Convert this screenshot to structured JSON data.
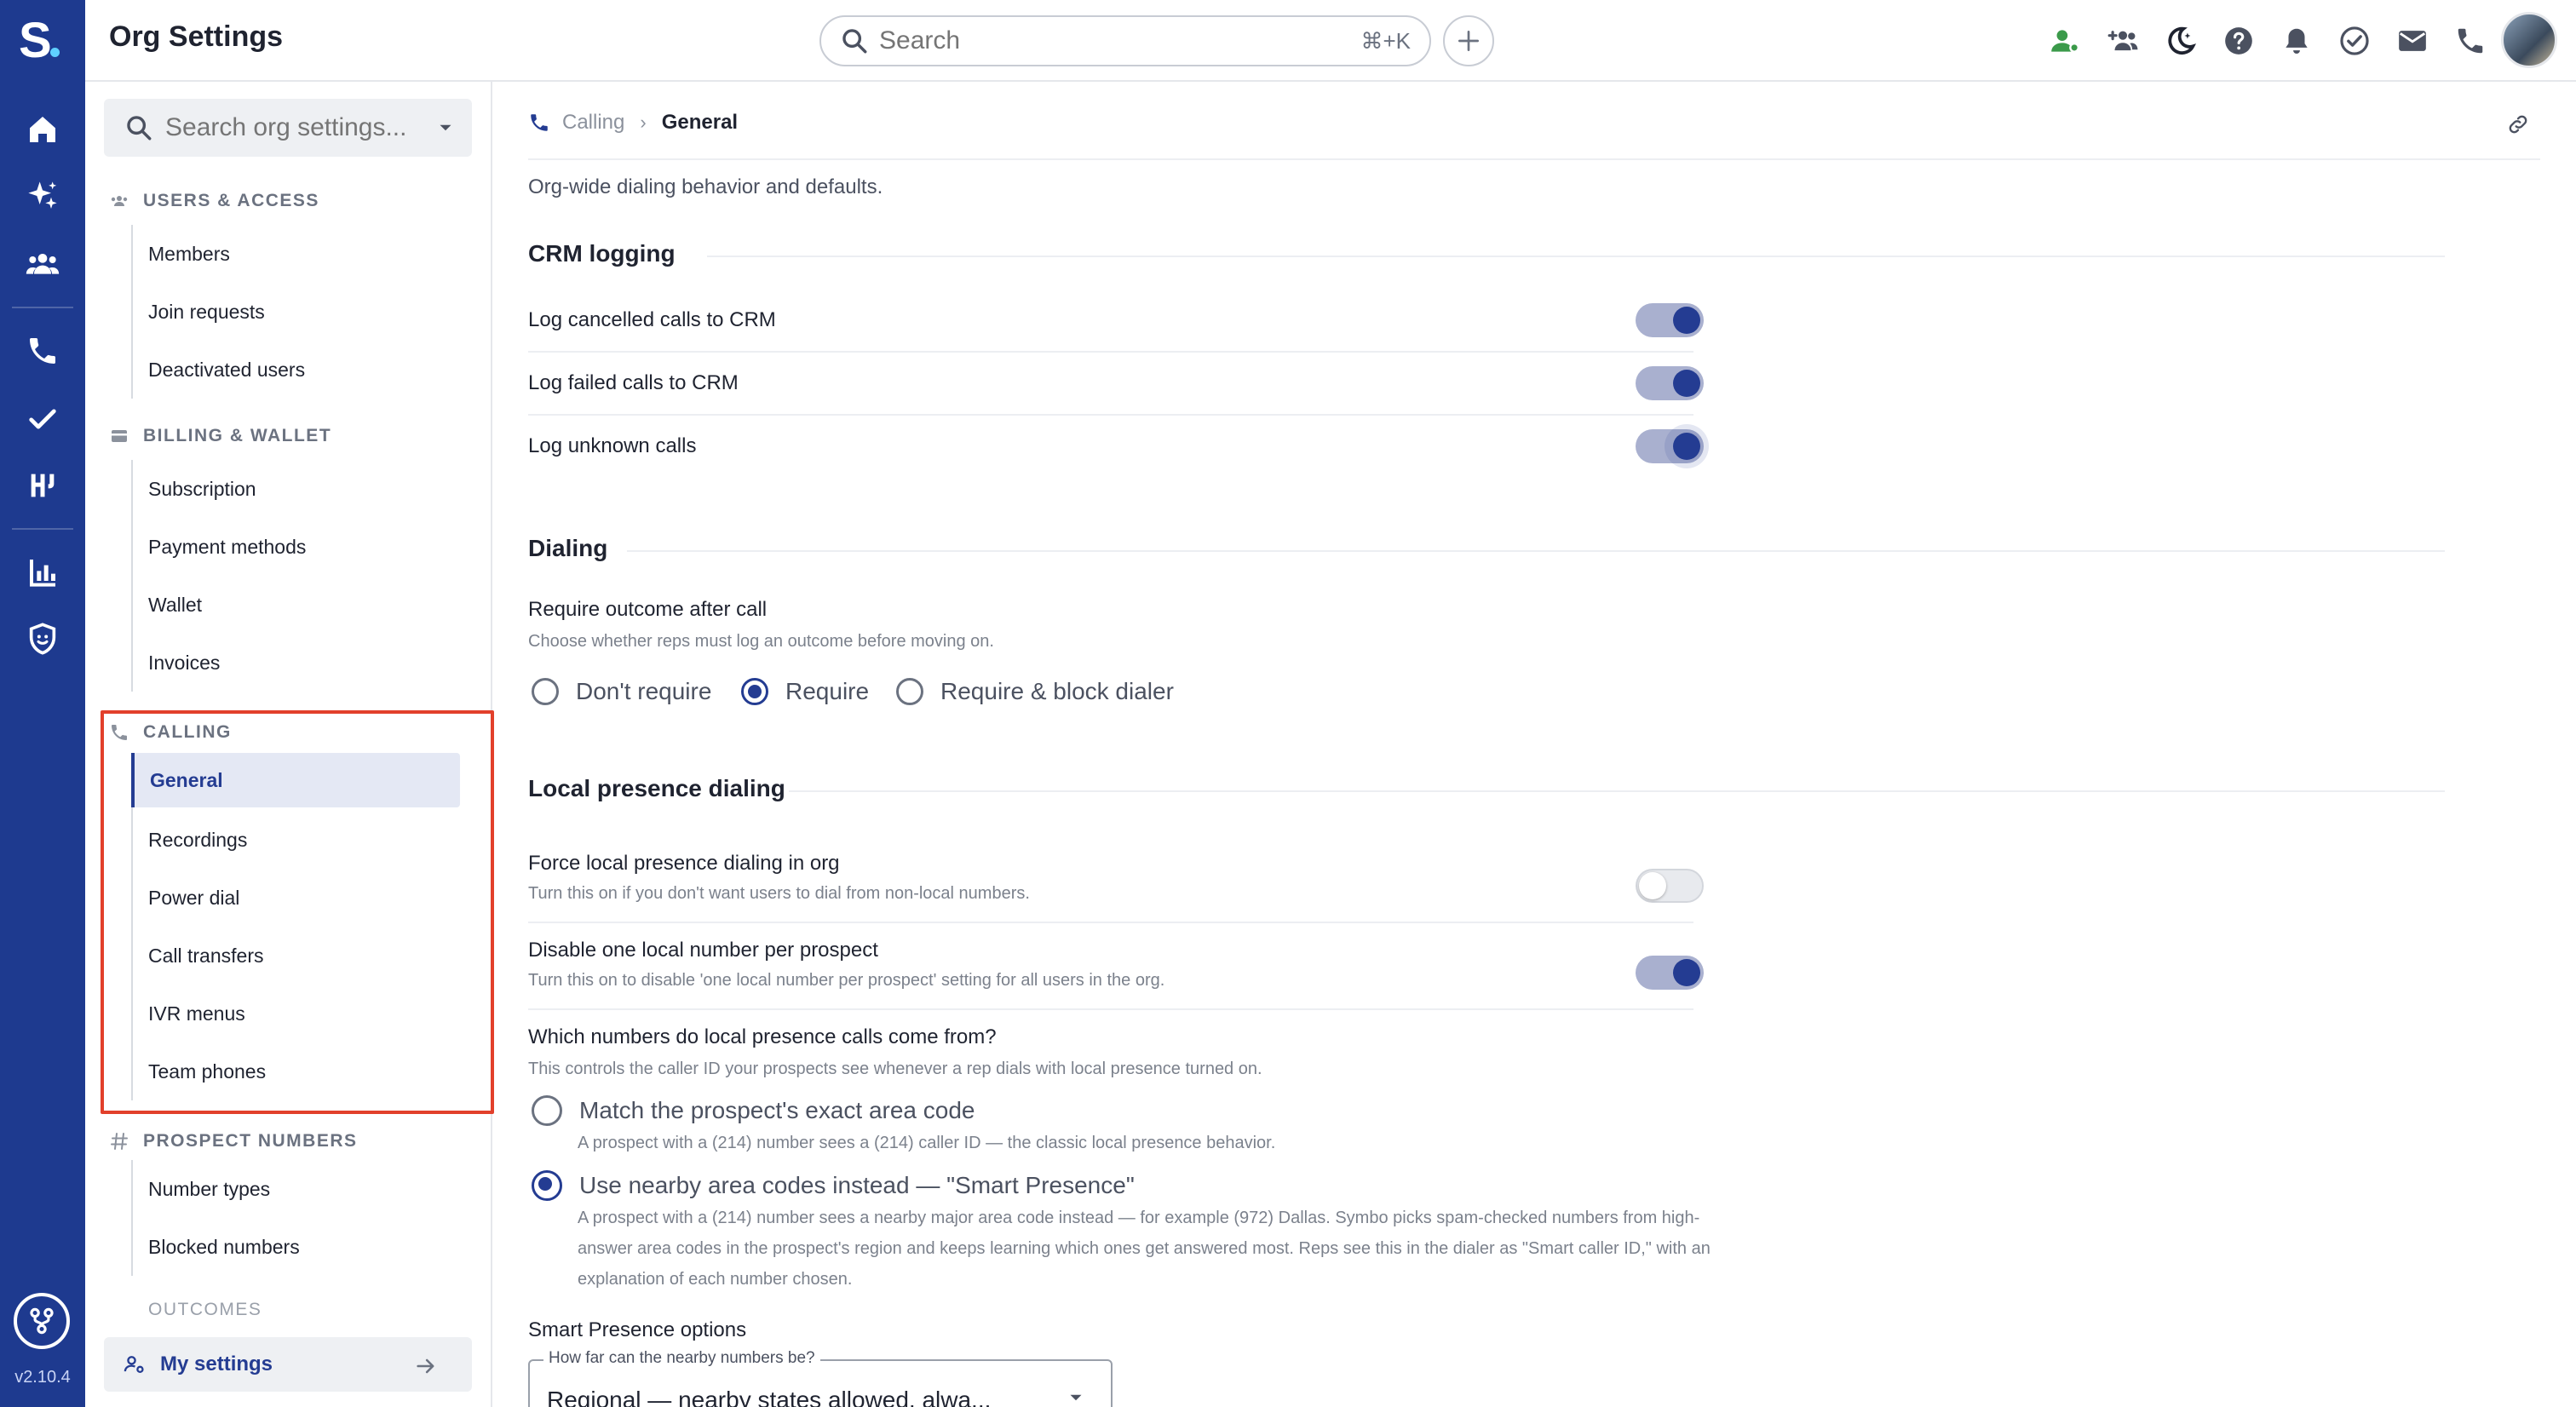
{
  "app": {
    "title": "Org Settings",
    "version": "v2.10.4",
    "accent": "#243c92",
    "rail_color": "#1e3a8f"
  },
  "topbar": {
    "search_placeholder": "Search",
    "search_shortcut": "⌘+K",
    "icons": [
      "user-status-icon",
      "add-group-icon",
      "dnd-moon-icon",
      "help-icon",
      "bell-icon",
      "task-check-icon",
      "mail-icon",
      "phone-icon"
    ]
  },
  "rail": {
    "icons": [
      "home-icon",
      "ai-sparkle-icon",
      "team-icon",
      "phone-icon",
      "check-icon",
      "integrations-icon",
      "analytics-icon",
      "shield-icon"
    ]
  },
  "sidebar": {
    "search_placeholder": "Search org settings...",
    "sections": [
      {
        "title": "USERS & ACCESS",
        "icon": "people-icon",
        "items": [
          "Members",
          "Join requests",
          "Deactivated users"
        ]
      },
      {
        "title": "BILLING & WALLET",
        "icon": "card-icon",
        "items": [
          "Subscription",
          "Payment methods",
          "Wallet",
          "Invoices"
        ]
      },
      {
        "title": "CALLING",
        "icon": "phone-icon",
        "items": [
          "General",
          "Recordings",
          "Power dial",
          "Call transfers",
          "IVR menus",
          "Team phones"
        ],
        "active": "General"
      },
      {
        "title": "PROSPECT NUMBERS",
        "icon": "hash-icon",
        "items": [
          "Number types",
          "Blocked numbers"
        ]
      }
    ],
    "faded_section": "OUTCOMES",
    "my_settings": "My settings"
  },
  "main": {
    "breadcrumb": {
      "parent": "Calling",
      "current": "General"
    },
    "description": "Org-wide dialing behavior and defaults.",
    "crm": {
      "title": "CRM logging",
      "rows": [
        {
          "label": "Log cancelled calls to CRM",
          "on": true
        },
        {
          "label": "Log failed calls to CRM",
          "on": true
        },
        {
          "label": "Log unknown calls",
          "on": true
        }
      ]
    },
    "dialing": {
      "title": "Dialing",
      "outcome_label": "Require outcome after call",
      "outcome_sub": "Choose whether reps must log an outcome before moving on.",
      "options": [
        "Don't require",
        "Require",
        "Require & block dialer"
      ],
      "selected": "Require"
    },
    "local": {
      "title": "Local presence dialing",
      "force_label": "Force local presence dialing in org",
      "force_sub": "Turn this on if you don't want users to dial from non-local numbers.",
      "force_on": false,
      "disable_label": "Disable one local number per prospect",
      "disable_sub": "Turn this on to disable 'one local number per prospect' setting for all users in the org.",
      "disable_on": true,
      "which_label": "Which numbers do local presence calls come from?",
      "which_sub": "This controls the caller ID your prospects see whenever a rep dials with local presence turned on.",
      "opt1_label": "Match the prospect's exact area code",
      "opt1_desc": "A prospect with a (214) number sees a (214) caller ID — the classic local presence behavior.",
      "opt2_label": "Use nearby area codes instead — \"Smart Presence\"",
      "opt2_desc": "A prospect with a (214) number sees a nearby major area code instead — for example (972) Dallas. Symbo picks spam-checked numbers from high-answer area codes in the prospect's region and keeps learning which ones get answered most. Reps see this in the dialer as \"Smart caller ID,\" with an explanation of each number chosen.",
      "selected": "opt2"
    },
    "smart": {
      "title": "Smart Presence options",
      "select_legend": "How far can the nearby numbers be?",
      "select_value": "Regional — nearby states allowed, alwa..."
    }
  }
}
